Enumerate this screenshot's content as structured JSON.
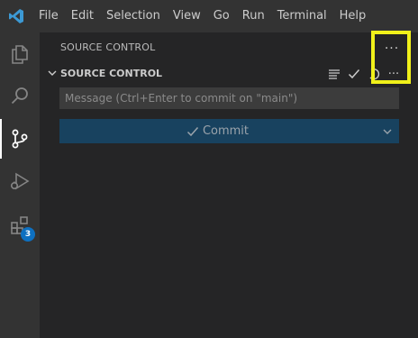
{
  "menu": {
    "items": [
      "File",
      "Edit",
      "Selection",
      "View",
      "Go",
      "Run",
      "Terminal",
      "Help"
    ]
  },
  "activity_bar": {
    "items": [
      {
        "icon": "files-icon"
      },
      {
        "icon": "search-icon"
      },
      {
        "icon": "source-control-icon",
        "active": true
      },
      {
        "icon": "run-debug-icon"
      },
      {
        "icon": "extensions-icon",
        "badge": "3"
      }
    ]
  },
  "sidebar": {
    "title": "SOURCE CONTROL",
    "more_label": "···",
    "section": {
      "title": "SOURCE CONTROL",
      "more_label": "···"
    },
    "message": {
      "placeholder": "Message (Ctrl+Enter to commit on \"main\")",
      "value": ""
    },
    "commit": {
      "label": "Commit"
    }
  },
  "colors": {
    "titlebar": "#333333",
    "activitybar": "#333333",
    "sidebar": "#252526",
    "commit_button": "#18425f",
    "highlight": "#f0f01a",
    "badge": "#0e70c0"
  }
}
